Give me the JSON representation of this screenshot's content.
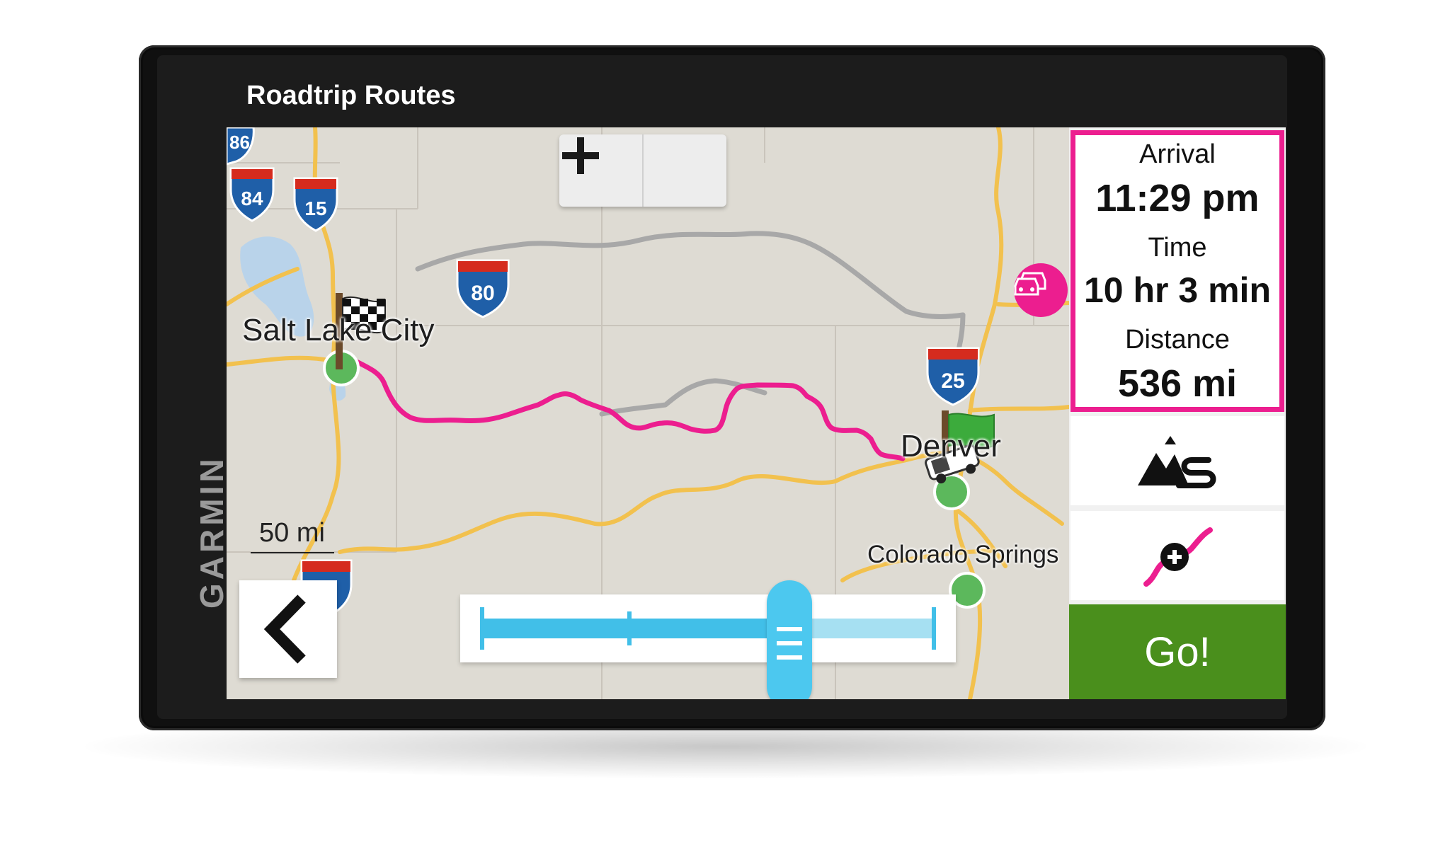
{
  "app": {
    "title": "Roadtrip Routes",
    "brand": "GARMIN"
  },
  "map": {
    "cities": {
      "origin": "Salt Lake City",
      "destination": "Denver",
      "other": "Colorado Springs"
    },
    "interstate_shields": [
      "86",
      "84",
      "15",
      "80",
      "25"
    ],
    "scale_label": "50 mi",
    "zoom": {
      "out_icon": "minus-icon",
      "in_icon": "plus-icon"
    },
    "slider_value_fraction": 0.68,
    "colors": {
      "route": "#ec1e8f",
      "highway": "#f2c14e",
      "alt_route": "#a8a8a8",
      "interstate": "#1f5fa8",
      "start_pin": "#5cb85c"
    }
  },
  "trip": {
    "arrival_label": "Arrival",
    "arrival_value": "11:29 pm",
    "time_label": "Time",
    "time_value": "10 hr 3 min",
    "distance_label": "Distance",
    "distance_value": "536 mi"
  },
  "actions": {
    "scenic_icon": "mountain-route-icon",
    "add_via_icon": "add-via-point-icon",
    "go_label": "Go!",
    "back_icon": "chevron-left-icon",
    "traffic_icon": "traffic-icon"
  }
}
